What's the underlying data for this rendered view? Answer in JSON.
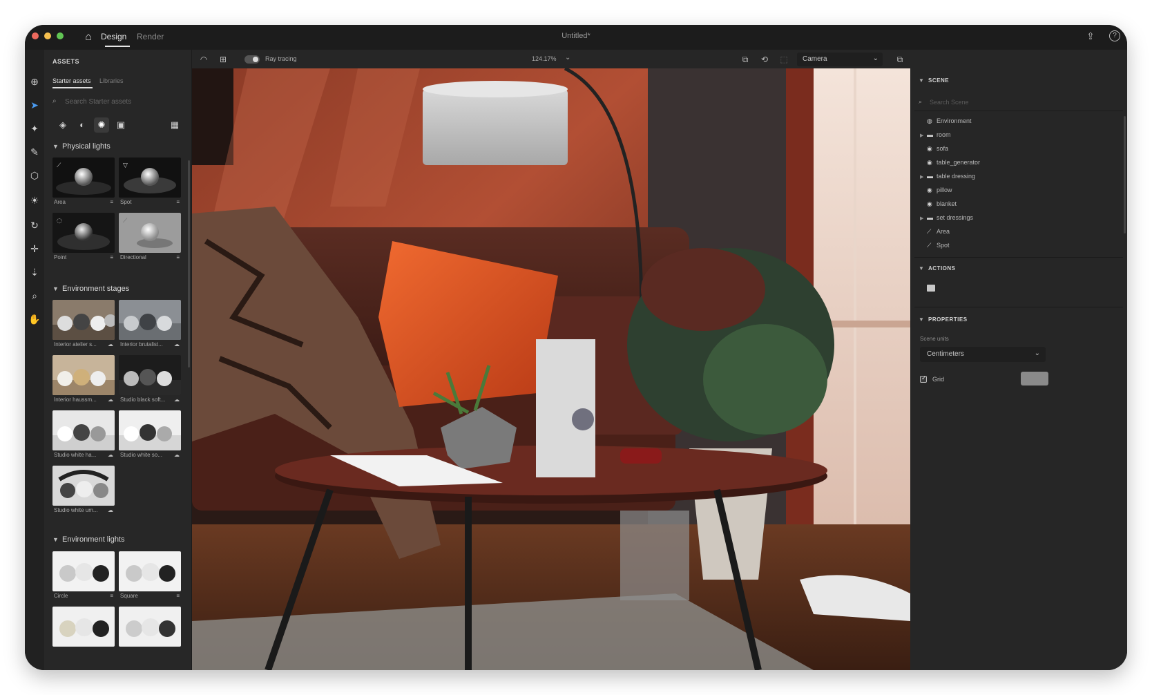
{
  "titlebar": {
    "traffic_colors": [
      "#ed6a5e",
      "#f5bf4f",
      "#61c554"
    ],
    "tabs": [
      {
        "label": "Design"
      },
      {
        "label": "Render"
      }
    ],
    "document_title": "Untitled*",
    "icons": [
      "home-icon",
      "share-icon",
      "help-icon"
    ]
  },
  "tools": [
    "add-icon",
    "select-arrow-icon",
    "magic-wand-icon",
    "eyedropper-icon",
    "box-icon",
    "sun-icon",
    "orbit-icon",
    "move-icon",
    "dolly-icon",
    "zoom-icon",
    "hand-icon"
  ],
  "assets": {
    "heading": "ASSETS",
    "subtabs": [
      {
        "label": "Starter assets"
      },
      {
        "label": "Libraries"
      }
    ],
    "search_placeholder": "Search Starter assets",
    "filters": [
      "models-filter-icon",
      "materials-filter-icon",
      "lights-filter-icon",
      "images-filter-icon",
      "grid-view-icon"
    ],
    "sections": [
      {
        "title": "Physical lights",
        "items": [
          {
            "label": "Area"
          },
          {
            "label": "Spot"
          },
          {
            "label": "Point"
          },
          {
            "label": "Directional"
          }
        ]
      },
      {
        "title": "Environment stages",
        "items": [
          {
            "label": "Interior atelier s..."
          },
          {
            "label": "Interior brutalist..."
          },
          {
            "label": "Interior haussm..."
          },
          {
            "label": "Studio black soft..."
          },
          {
            "label": "Studio white ha..."
          },
          {
            "label": "Studio white so..."
          },
          {
            "label": "Studio white um..."
          }
        ]
      },
      {
        "title": "Environment lights",
        "items": [
          {
            "label": "Circle"
          },
          {
            "label": "Square"
          }
        ]
      }
    ]
  },
  "viewport": {
    "ray_tracing_label": "Ray tracing",
    "ray_tracing_on": true,
    "zoom": "124.17%",
    "camera": "Camera"
  },
  "scene": {
    "heading": "SCENE",
    "search_placeholder": "Search Scene",
    "items": [
      {
        "label": "Environment",
        "expandable": false
      },
      {
        "label": "room",
        "expandable": true
      },
      {
        "label": "sofa",
        "expandable": false
      },
      {
        "label": "table_generator",
        "expandable": false
      },
      {
        "label": "table dressing",
        "expandable": true
      },
      {
        "label": "pillow",
        "expandable": false
      },
      {
        "label": "blanket",
        "expandable": false
      },
      {
        "label": "set dressings",
        "expandable": true
      },
      {
        "label": "Area",
        "expandable": false
      },
      {
        "label": "Spot",
        "expandable": false
      }
    ]
  },
  "actions": {
    "heading": "ACTIONS"
  },
  "properties": {
    "heading": "PROPERTIES",
    "scene_units_label": "Scene units",
    "scene_units_value": "Centimeters",
    "grid_label": "Grid",
    "grid_checked": true,
    "grid_color": "#8a8a8a"
  }
}
